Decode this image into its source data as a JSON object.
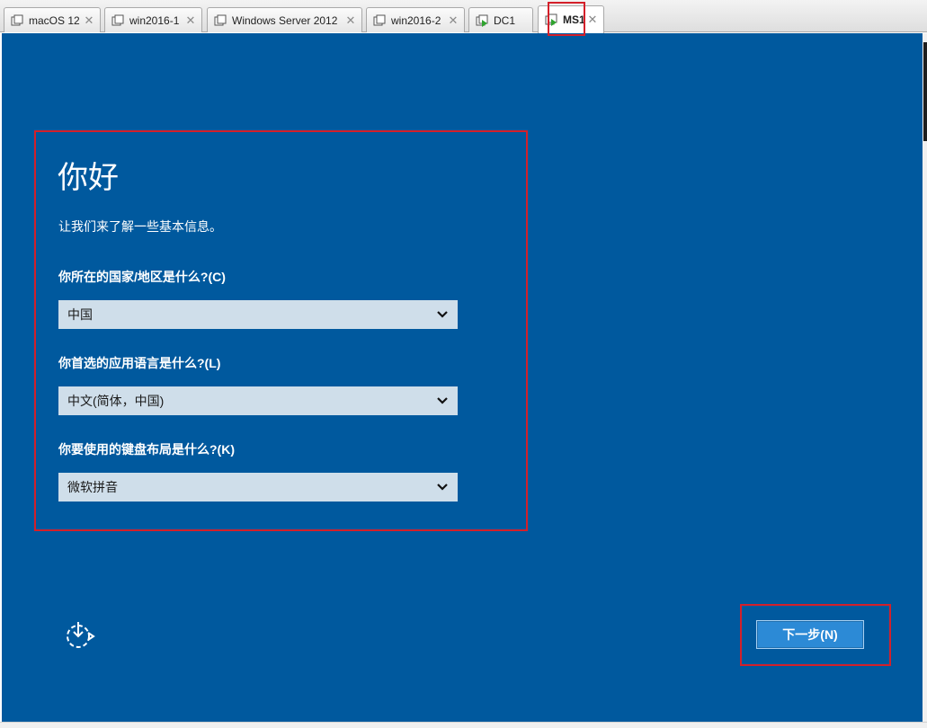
{
  "tabs": [
    {
      "label": "macOS 12",
      "active": false,
      "icon": "vm-icon"
    },
    {
      "label": "win2016-1",
      "active": false,
      "icon": "vm-icon"
    },
    {
      "label": "Windows Server 2012",
      "active": false,
      "icon": "vm-icon"
    },
    {
      "label": "win2016-2",
      "active": false,
      "icon": "vm-icon"
    },
    {
      "label": "DC1",
      "active": false,
      "icon": "vm-running-icon"
    },
    {
      "label": "MS1",
      "active": true,
      "icon": "vm-running-icon"
    }
  ],
  "tab_close_glyph": "✕",
  "oobe": {
    "title": "你好",
    "subtitle": "让我们来了解一些基本信息。",
    "country_question": "你所在的国家/地区是什么?(C)",
    "country_value": "中国",
    "language_question": "你首选的应用语言是什么?(L)",
    "language_value": "中文(简体，中国)",
    "keyboard_question": "你要使用的键盘布局是什么?(K)",
    "keyboard_value": "微软拼音",
    "next_label": "下一步(N)"
  },
  "colors": {
    "background": "#00599e",
    "select_bg": "#cfdeea",
    "button_bg": "#2c8ad6",
    "annotation": "#d4202a"
  }
}
